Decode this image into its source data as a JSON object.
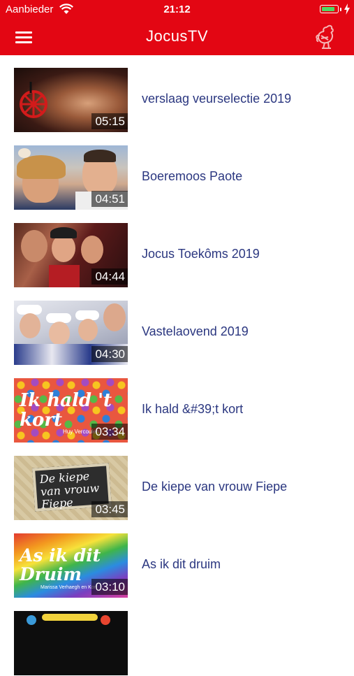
{
  "status_bar": {
    "carrier": "Aanbieder",
    "time": "21:12",
    "battery_level": 0.9
  },
  "nav": {
    "title": "JocusTV",
    "menu_icon": "hamburger-menu-icon",
    "logo_icon": "rooster-logo-icon"
  },
  "colors": {
    "brand_red": "#e30613",
    "title_blue": "#2b3780"
  },
  "videos": [
    {
      "title": "verslaag veurselectie 2019",
      "duration": "05:15"
    },
    {
      "title": "Boeremoos Paote",
      "duration": "04:51"
    },
    {
      "title": "Jocus Toekôms 2019",
      "duration": "04:44"
    },
    {
      "title": "Vastelaovend 2019",
      "duration": "04:30"
    },
    {
      "title": "Ik hald &#39;t kort",
      "duration": "03:34",
      "thumb_text": "Ik hald 't kort",
      "thumb_credit": "Huy Vercoulen"
    },
    {
      "title": "De kiepe van vrouw Fiepe",
      "duration": "03:45",
      "thumb_text": "De kiepe van vrouw Fiepe"
    },
    {
      "title": "As ik dit druim",
      "duration": "03:10",
      "thumb_text": "As ik dit Druim",
      "thumb_credit": "Marissa Verhaegh en Kort"
    },
    {
      "title": "",
      "duration": ""
    }
  ]
}
